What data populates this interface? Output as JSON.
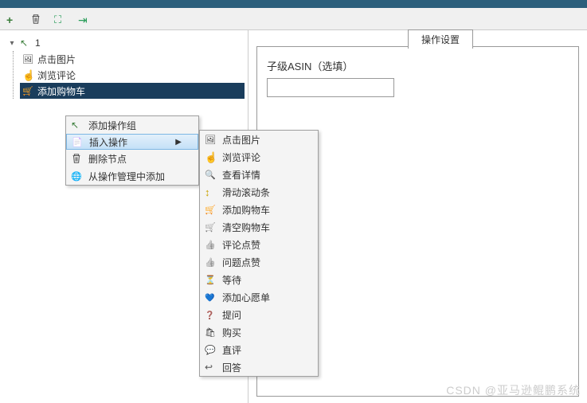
{
  "toolbar": {
    "add": "+",
    "delete": "删除",
    "expand": "展开",
    "collapse": "折叠"
  },
  "tree": {
    "root": "1",
    "nodes": [
      {
        "label": "点击图片",
        "icon": "image"
      },
      {
        "label": "浏览评论",
        "icon": "pointer"
      },
      {
        "label": "添加购物车",
        "icon": "cart-orange",
        "selected": true
      }
    ]
  },
  "context_menu_1": {
    "items": [
      {
        "label": "添加操作组",
        "icon": "cursor-plus"
      },
      {
        "label": "插入操作",
        "icon": "doc-arrow",
        "submenu": true,
        "highlighted": true
      },
      {
        "label": "删除节点",
        "icon": "trash"
      },
      {
        "label": "从操作管理中添加",
        "icon": "globe"
      }
    ]
  },
  "context_menu_2": {
    "items": [
      {
        "label": "点击图片",
        "icon": "image"
      },
      {
        "label": "浏览评论",
        "icon": "pointer"
      },
      {
        "label": "查看详情",
        "icon": "search"
      },
      {
        "label": "滑动滚动条",
        "icon": "scroll"
      },
      {
        "label": "添加购物车",
        "icon": "cart-orange"
      },
      {
        "label": "清空购物车",
        "icon": "cart"
      },
      {
        "label": "评论点赞",
        "icon": "thumb"
      },
      {
        "label": "问题点赞",
        "icon": "thumb"
      },
      {
        "label": "等待",
        "icon": "hourglass"
      },
      {
        "label": "添加心愿单",
        "icon": "heart"
      },
      {
        "label": "提问",
        "icon": "question"
      },
      {
        "label": "购买",
        "icon": "buy"
      },
      {
        "label": "直评",
        "icon": "chat"
      },
      {
        "label": "回答",
        "icon": "reply"
      }
    ]
  },
  "settings": {
    "tab_title": "操作设置",
    "field_label": "子级ASIN（选填）",
    "field_value": ""
  },
  "watermark": "CSDN @亚马逊鲲鹏系统"
}
